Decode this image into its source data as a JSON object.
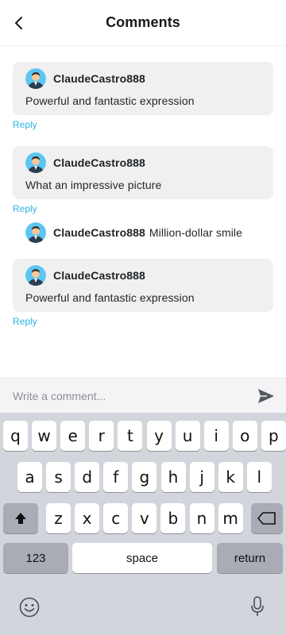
{
  "header": {
    "title": "Comments"
  },
  "comments": [
    {
      "user": "ClaudeCastro888",
      "text": "Powerful and fantastic expression",
      "reply": "Reply"
    },
    {
      "user": "ClaudeCastro888",
      "text": "What an impressive picture",
      "reply": "Reply"
    },
    {
      "user": "ClaudeCastro888",
      "text": "Million-dollar smile"
    },
    {
      "user": "ClaudeCastro888",
      "text": "Powerful and fantastic expression",
      "reply": "Reply"
    }
  ],
  "compose": {
    "placeholder": "Write a comment..."
  },
  "keyboard": {
    "row1": [
      "q",
      "w",
      "e",
      "r",
      "t",
      "y",
      "u",
      "i",
      "o",
      "p"
    ],
    "row2": [
      "a",
      "s",
      "d",
      "f",
      "g",
      "h",
      "j",
      "k",
      "l"
    ],
    "row3": [
      "z",
      "x",
      "c",
      "v",
      "b",
      "n",
      "m"
    ],
    "numbers_label": "123",
    "space_label": "space",
    "return_label": "return",
    "icons": {
      "shift": "shift-icon",
      "delete": "backspace-icon",
      "emoji": "emoji-icon",
      "mic": "microphone-icon"
    }
  },
  "colors": {
    "reply": "#2fb3e3",
    "bubble": "#f0f0f0",
    "keyboard_bg": "#d3d5dc",
    "avatar_bg": "#5cc6f2"
  }
}
